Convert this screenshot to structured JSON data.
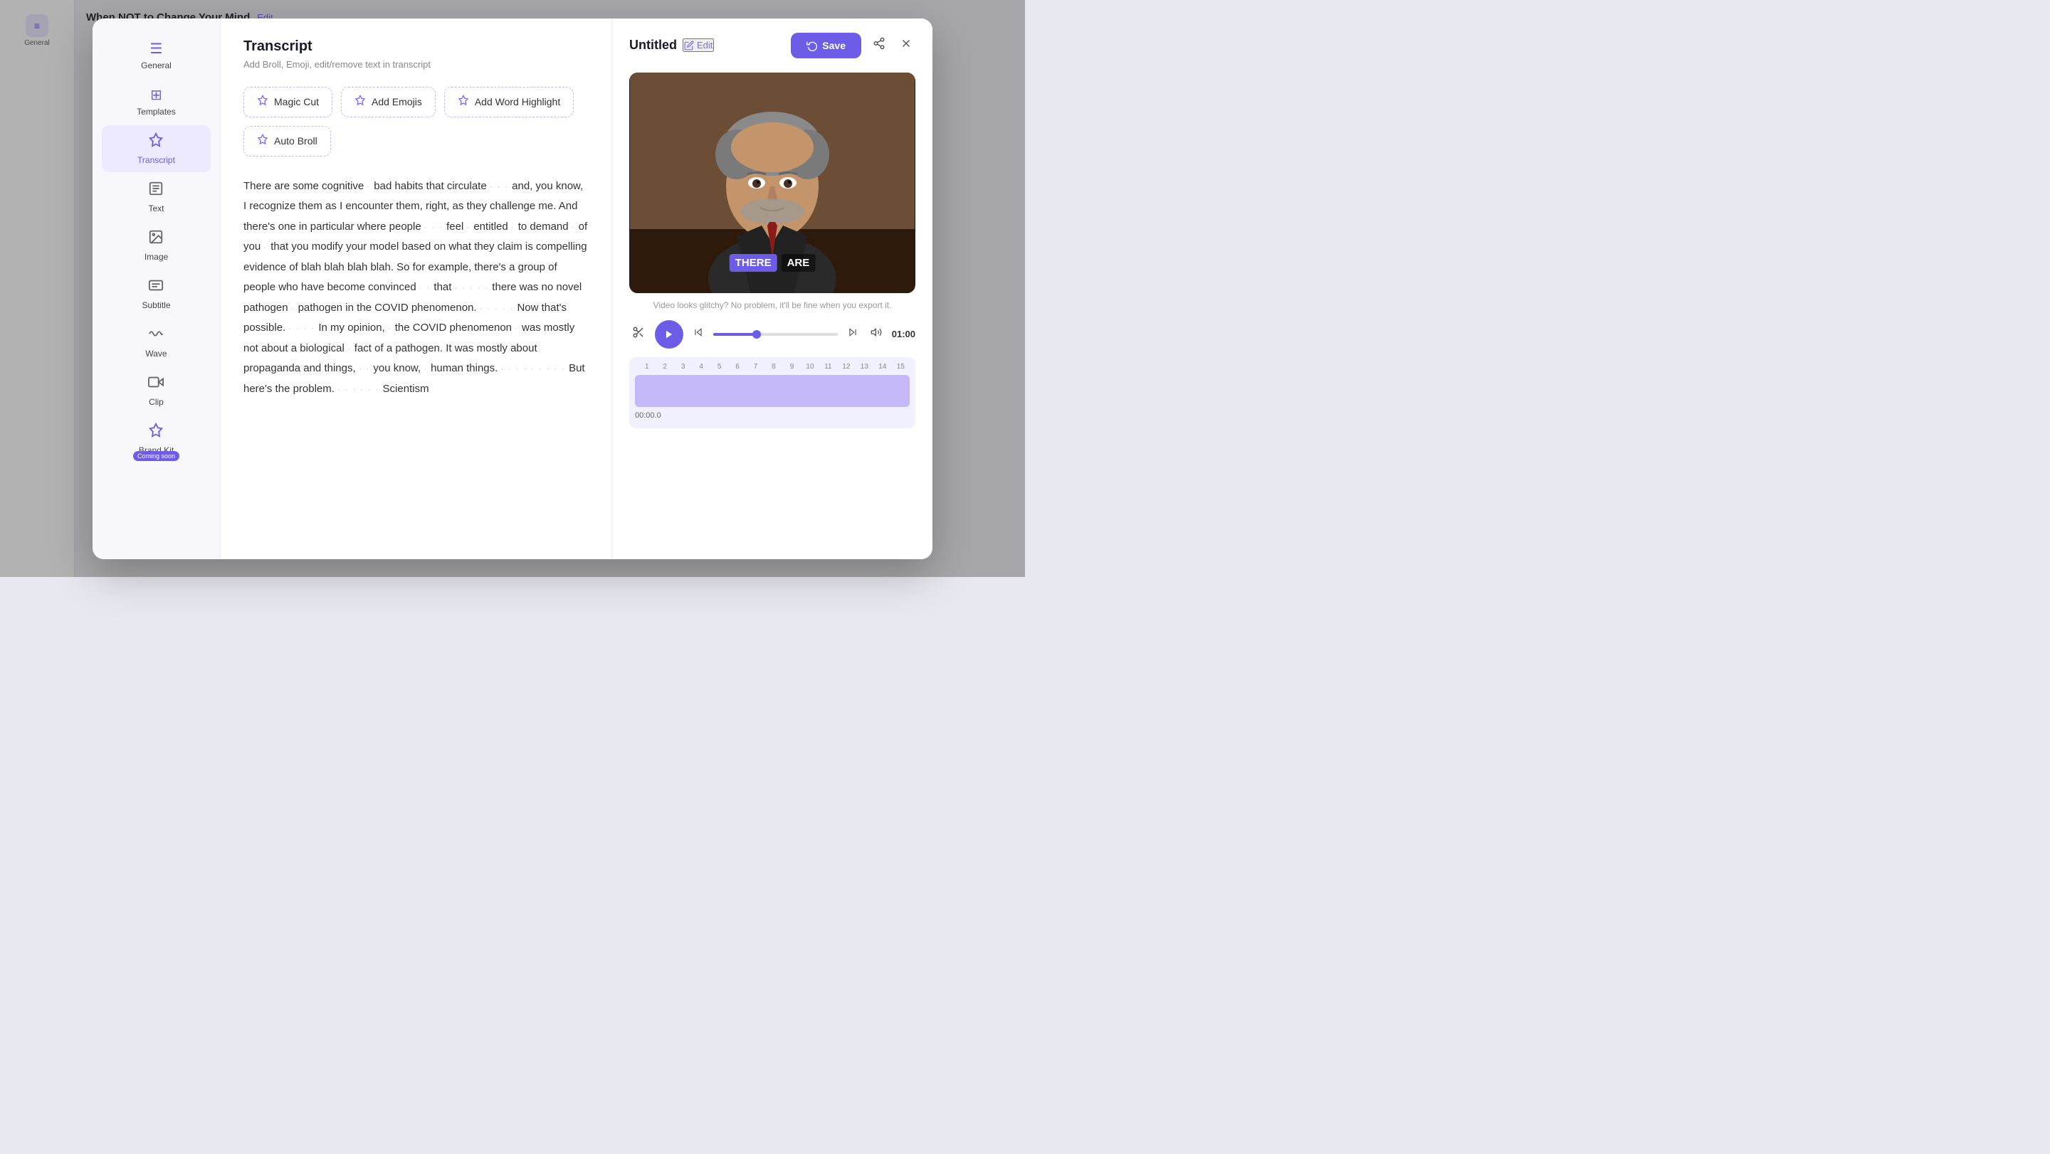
{
  "app": {
    "title": "When NOT to Change Your Mind",
    "edit_label": "Edit"
  },
  "modal": {
    "title": "Untitled",
    "edit_label": "Edit",
    "save_label": "Save"
  },
  "transcript": {
    "title": "Transcript",
    "subtitle": "Add Broll, Emoji, edit/remove text in transcript",
    "buttons": [
      {
        "id": "magic-cut",
        "label": "Magic Cut"
      },
      {
        "id": "add-emojis",
        "label": "Add Emojis"
      },
      {
        "id": "add-word-highlight",
        "label": "Add Word Highlight"
      },
      {
        "id": "auto-broll",
        "label": "Auto Broll"
      }
    ],
    "text": "There are some cognitive · bad habits that circulate · · · and, you know, I recognize them as I encounter them, right, as they challenge me. And there's one in particular where people · · · feel · entitled · to demand · of you · that you modify your model based on what they claim is compelling evidence of blah blah blah blah. So for example, there's a group of people who have become convinced · · that · · · · · there was no novel pathogen · pathogen in the COVID phenomenon. · · · · · Now that's possible. · · · · In my opinion, · the COVID phenomenon · was mostly not about a biological · fact of a pathogen. It was mostly about propaganda and things, · · you know, · human things. · · · · · · · · · But here's the problem. · · · · · · Scientism"
  },
  "sidebar": {
    "items": [
      {
        "id": "general",
        "label": "General",
        "icon": "≡"
      },
      {
        "id": "templates",
        "label": "Templates",
        "icon": "⊞"
      },
      {
        "id": "transcript",
        "label": "Transcript",
        "icon": "✦",
        "active": true
      },
      {
        "id": "text",
        "label": "Text",
        "icon": "⊡"
      },
      {
        "id": "image",
        "label": "Image",
        "icon": "🖼"
      },
      {
        "id": "subtitle",
        "label": "Subtitle",
        "icon": "CC"
      },
      {
        "id": "wave",
        "label": "Wave",
        "icon": "≋"
      },
      {
        "id": "clip",
        "label": "Clip",
        "icon": "🎬"
      },
      {
        "id": "brand-kit",
        "label": "Brand Kit",
        "icon": "✦",
        "badge": "Coming soon"
      }
    ]
  },
  "video": {
    "caption_words": [
      {
        "text": "THERE",
        "highlighted": true
      },
      {
        "text": "ARE",
        "highlighted": false
      }
    ],
    "glitch_notice": "Video looks glitchy? No problem, it'll be fine when you export it.",
    "time_display": "01:00",
    "timestamp": "00:00.0"
  },
  "timeline": {
    "ticks": [
      "1",
      "2",
      "3",
      "4",
      "5",
      "6",
      "7",
      "8",
      "9",
      "10",
      "11",
      "12",
      "13",
      "14",
      "15"
    ]
  }
}
